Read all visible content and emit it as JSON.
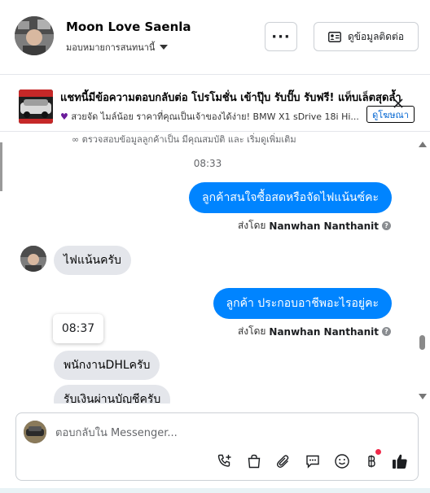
{
  "header": {
    "contact_name": "Moon Love Saenla",
    "assign_label": "มอบหมายการสนทนานี้",
    "more_label": "···",
    "contact_info_label": "ดูข้อมูลติดต่อ"
  },
  "ad": {
    "title": "แชทนี้มีข้อความตอบกลับต่อ โปรโมชั่น เข้าปุ๊บ รับปั๊บ รับฟรี! แท็บเล็ตสุดล้ำ",
    "subtitle": "สวยจัด ไมล์น้อย ราคาที่คุณเป็นเจ้าของได้ง่าย! BMW X1 sDrive 18i Hi...",
    "link_label": "ดูโฆษณา"
  },
  "conversation": {
    "cutoff_text": "ตรวจสอบข้อมูลลูกค้าเป็น มีคุณสมบัติ และ เริ่มดูเพิ่มเติม",
    "time_1": "08:33",
    "msg_out_1": "ลูกค้าสนใจซื้อสดหรือจัดไฟแน้นซ์คะ",
    "sent_by_label": "ส่งโดย",
    "sender_name": "Nanwhan Nanthanit",
    "msg_in_1": "ไฟแน้นครับ",
    "msg_out_2": "ลูกค้า ประกอบอาชีพอะไรอยู่คะ",
    "tooltip_time": "08:37",
    "msg_in_2": "พนักงานDHLครับ",
    "msg_in_3": "รับเงินผ่านบัญชีครับ"
  },
  "composer": {
    "placeholder": "ตอบกลับใน Messenger..."
  },
  "colors": {
    "accent": "#0084ff",
    "incoming_bubble": "#e4e6eb",
    "notification_dot": "#f02849"
  }
}
